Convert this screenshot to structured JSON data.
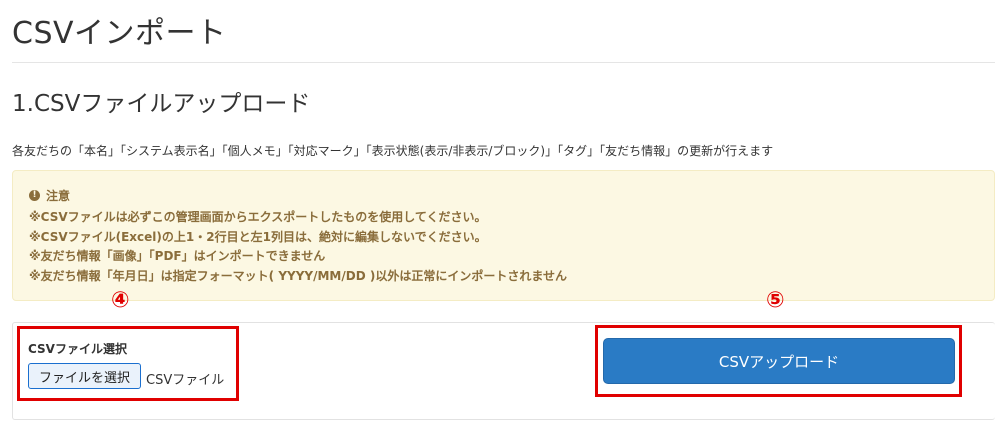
{
  "page": {
    "title": "CSVインポート"
  },
  "section": {
    "title": "1.CSVファイルアップロード",
    "description": "各友だちの「本名」「システム表示名」「個人メモ」「対応マーク」「表示状態(表示/非表示/ブロック)」「タグ」「友だち情報」の更新が行えます"
  },
  "notice": {
    "icon": "info-circle-icon",
    "heading": "注意",
    "lines": [
      "※CSVファイルは必ずこの管理画面からエクスポートしたものを使用してください。",
      "※CSVファイル(Excel)の上1・2行目と左1列目は、絶対に編集しないでください。",
      "※友だち情報「画像」「PDF」はインポートできません",
      "※友だち情報「年月日」は指定フォーマット( YYYY/MM/DD )以外は正常にインポートされません"
    ],
    "colors": {
      "background": "#fcf8e3",
      "text": "#8a6d3b"
    }
  },
  "form": {
    "file_label": "CSVファイル選択",
    "file_button_label": "ファイルを選択",
    "file_status": "CSVファイル",
    "upload_button_label": "CSVアップロード"
  },
  "annotations": {
    "callout_4": "④",
    "callout_5": "⑤",
    "color": "#e00000"
  },
  "colors": {
    "upload_button": "#2a7bc5",
    "file_button_border": "#1a6fcf"
  }
}
